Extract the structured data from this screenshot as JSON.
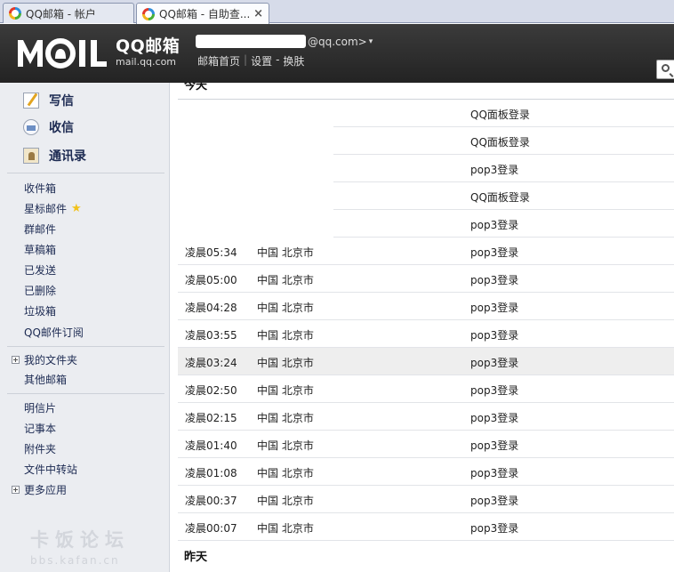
{
  "browser": {
    "tabs": [
      {
        "title": "QQ邮箱 - 帐户",
        "active": false
      },
      {
        "title": "QQ邮箱 - 自助查...",
        "active": true
      }
    ],
    "close_glyph": "×"
  },
  "header": {
    "logo_big": "QQ邮箱",
    "logo_small": "mail.qq.com",
    "account_suffix": "@qq.com>",
    "account_arrow": "▾",
    "links": [
      "邮箱首页",
      "设置",
      "换肤"
    ],
    "separator_bar": "|",
    "separator_dash": "-"
  },
  "sidebar": {
    "actions": [
      {
        "label": "写信",
        "icon": "write-icon"
      },
      {
        "label": "收信",
        "icon": "inbox-icon"
      },
      {
        "label": "通讯录",
        "icon": "contacts-icon"
      }
    ],
    "folders": [
      "收件箱",
      "星标邮件",
      "群邮件",
      "草稿箱",
      "已发送",
      "已删除",
      "垃圾箱",
      "QQ邮件订阅"
    ],
    "star_glyph": "★",
    "my_folders": "我的文件夹",
    "other_mailboxes": "其他邮箱",
    "tools": [
      "明信片",
      "记事本",
      "附件夹",
      "文件中转站"
    ],
    "more_apps": "更多应用"
  },
  "watermark": {
    "big": "卡饭论坛",
    "small": "bbs.kafan.cn"
  },
  "login_log": {
    "today_label": "今天",
    "yesterday_label": "昨天",
    "rows": [
      {
        "time": "",
        "location": "",
        "type": "QQ面板登录",
        "redacted": true
      },
      {
        "time": "",
        "location": "",
        "type": "QQ面板登录",
        "redacted": true
      },
      {
        "time": "",
        "location": "",
        "type": "pop3登录",
        "redacted": true
      },
      {
        "time": "",
        "location": "",
        "type": "QQ面板登录",
        "redacted": true
      },
      {
        "time": "",
        "location": "",
        "type": "pop3登录",
        "redacted": true
      },
      {
        "time": "凌晨05:34",
        "location": "中国 北京市",
        "type": "pop3登录"
      },
      {
        "time": "凌晨05:00",
        "location": "中国 北京市",
        "type": "pop3登录"
      },
      {
        "time": "凌晨04:28",
        "location": "中国 北京市",
        "type": "pop3登录"
      },
      {
        "time": "凌晨03:55",
        "location": "中国 北京市",
        "type": "pop3登录"
      },
      {
        "time": "凌晨03:24",
        "location": "中国 北京市",
        "type": "pop3登录",
        "highlighted": true
      },
      {
        "time": "凌晨02:50",
        "location": "中国 北京市",
        "type": "pop3登录"
      },
      {
        "time": "凌晨02:15",
        "location": "中国 北京市",
        "type": "pop3登录"
      },
      {
        "time": "凌晨01:40",
        "location": "中国 北京市",
        "type": "pop3登录"
      },
      {
        "time": "凌晨01:08",
        "location": "中国 北京市",
        "type": "pop3登录"
      },
      {
        "time": "凌晨00:37",
        "location": "中国 北京市",
        "type": "pop3登录"
      },
      {
        "time": "凌晨00:07",
        "location": "中国 北京市",
        "type": "pop3登录"
      }
    ]
  }
}
